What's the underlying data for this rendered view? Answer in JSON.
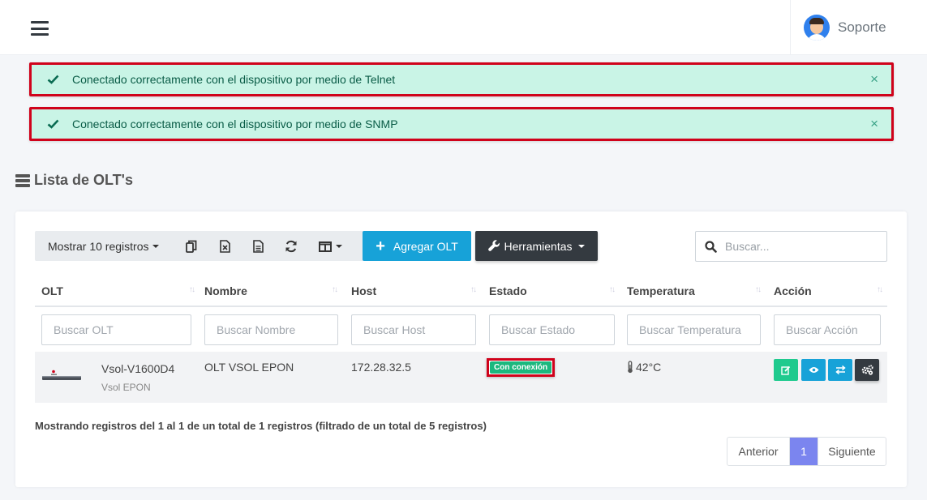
{
  "header": {
    "user_name": "Soporte"
  },
  "alerts": [
    {
      "message": "Conectado correctamente con el dispositivo por medio de Telnet",
      "close": "×"
    },
    {
      "message": "Conectado correctamente con el dispositivo por medio de SNMP",
      "close": "×"
    }
  ],
  "page": {
    "title": "Lista de OLT's"
  },
  "toolbar": {
    "length_label": "Mostrar 10 registros",
    "add_label": "Agregar OLT",
    "tools_label": "Herramientas",
    "search_placeholder": "Buscar..."
  },
  "table": {
    "columns": [
      "OLT",
      "Nombre",
      "Host",
      "Estado",
      "Temperatura",
      "Acción"
    ],
    "filters": [
      "Buscar OLT",
      "Buscar Nombre",
      "Buscar Host",
      "Buscar Estado",
      "Buscar Temperatura",
      "Buscar Acción"
    ],
    "rows": [
      {
        "model": "Vsol-V1600D4",
        "brand": "Vsol EPON",
        "name": "OLT VSOL EPON",
        "host": "172.28.32.5",
        "status": "Con conexión",
        "temperature": "42°C"
      }
    ]
  },
  "footer": {
    "info": "Mostrando registros del 1 al 1 de un total de 1 registros (filtrado de un total de 5 registros)",
    "prev": "Anterior",
    "current_page": "1",
    "next": "Siguiente"
  },
  "colors": {
    "success_alert": "#c9f4e6",
    "info": "#17a2d8",
    "dark": "#343a40",
    "success": "#1fca8e",
    "page_active": "#7b85ef"
  }
}
